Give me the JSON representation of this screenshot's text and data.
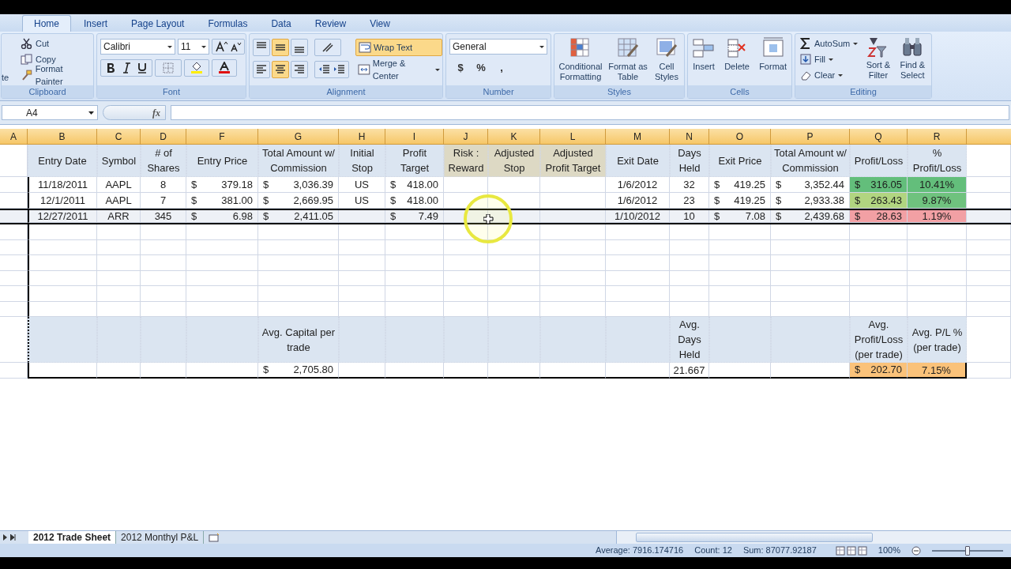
{
  "ribbon_tabs": [
    {
      "label": "Home",
      "selected": true
    },
    {
      "label": "Insert",
      "selected": false
    },
    {
      "label": "Page Layout",
      "selected": false
    },
    {
      "label": "Formulas",
      "selected": false
    },
    {
      "label": "Data",
      "selected": false
    },
    {
      "label": "Review",
      "selected": false
    },
    {
      "label": "View",
      "selected": false
    }
  ],
  "clipboard": {
    "group": "Clipboard",
    "paste_label": "te",
    "items": [
      "Cut",
      "Copy",
      "Format Painter"
    ]
  },
  "font": {
    "group": "Font",
    "name": "Calibri",
    "size": "11"
  },
  "alignment": {
    "group": "Alignment",
    "vertical_buttons": [
      {
        "selected": false
      },
      {
        "selected": true
      },
      {
        "selected": false
      }
    ],
    "horizontal_buttons": [
      {
        "selected": false
      },
      {
        "selected": true
      },
      {
        "selected": false
      }
    ],
    "wrap_text": {
      "label": "Wrap Text",
      "on": true
    },
    "merge": "Merge & Center"
  },
  "number": {
    "group": "Number",
    "format": "General",
    "symbols": [
      "$",
      "%",
      ","
    ]
  },
  "styles": {
    "group": "Styles",
    "items": [
      "Conditional Formatting",
      "Format as Table",
      "Cell Styles"
    ]
  },
  "cells": {
    "group": "Cells",
    "items": [
      "Insert",
      "Delete",
      "Format"
    ]
  },
  "editing": {
    "group": "Editing",
    "items": [
      "AutoSum",
      "Fill",
      "Clear"
    ],
    "big_items": [
      "Sort & Filter",
      "Find & Select"
    ]
  },
  "formula_bar": {
    "name_box": "A4",
    "function_label": "fx"
  },
  "sheet": {
    "columns": [
      {
        "letter": "A",
        "selected": true
      },
      {
        "letter": "B",
        "selected": true
      },
      {
        "letter": "C",
        "selected": true
      },
      {
        "letter": "D",
        "selected": true
      },
      {
        "letter": "F",
        "selected": true
      },
      {
        "letter": "G",
        "selected": true
      },
      {
        "letter": "H",
        "selected": true
      },
      {
        "letter": "I",
        "selected": true
      },
      {
        "letter": "J",
        "selected": true
      },
      {
        "letter": "K",
        "selected": true
      },
      {
        "letter": "L",
        "selected": true
      },
      {
        "letter": "M",
        "selected": true
      },
      {
        "letter": "N",
        "selected": true
      },
      {
        "letter": "O",
        "selected": true
      },
      {
        "letter": "P",
        "selected": true
      },
      {
        "letter": "Q",
        "selected": true
      },
      {
        "letter": "R",
        "selected": true
      }
    ],
    "header": {
      "b": {
        "text": "Entry Date",
        "color": "#dbe5f1"
      },
      "c": {
        "text": "Symbol",
        "color": "#dbe5f1"
      },
      "d": {
        "text": "# of Shares",
        "color": "#dbe5f1"
      },
      "f": {
        "text": "Entry Price",
        "color": "#dbe5f1"
      },
      "g": {
        "text": "Total Amount w/ Commission",
        "color": "#dbe5f1"
      },
      "h": {
        "text": "Initial Stop",
        "color": "#dbe5f1"
      },
      "i": {
        "text": "Profit Target",
        "color": "#dbe5f1"
      },
      "j": {
        "text": "Risk : Reward",
        "color": "#ddd9c4"
      },
      "k": {
        "text": "Adjusted Stop",
        "color": "#ddd9c4"
      },
      "l": {
        "text": "Adjusted Profit Target",
        "color": "#ddd9c4"
      },
      "m": {
        "text": "Exit Date",
        "color": "#dbe5f1"
      },
      "n": {
        "text": "Days Held",
        "color": "#dbe5f1"
      },
      "o": {
        "text": "Exit Price",
        "color": "#dbe5f1"
      },
      "p": {
        "text": "Total Amount w/ Commission",
        "color": "#dbe5f1"
      },
      "q": {
        "text": "Profit/Loss",
        "color": "#dbe5f1"
      },
      "r": {
        "text": "% Profit/Loss",
        "color": "#dbe5f1"
      }
    },
    "rows": [
      {
        "selected": false,
        "cells": {
          "b": {
            "text": "11/18/2011"
          },
          "c": {
            "text": "AAPL"
          },
          "d": {
            "text": "8"
          },
          "f": {
            "currency": "$",
            "amount": "379.18"
          },
          "g": {
            "currency": "$",
            "amount": "3,036.39"
          },
          "h": {
            "text": "US"
          },
          "i": {
            "currency": "$",
            "amount": "418.00"
          },
          "m": {
            "text": "1/6/2012"
          },
          "n": {
            "text": "32"
          },
          "o": {
            "currency": "$",
            "amount": "419.25"
          },
          "p": {
            "currency": "$",
            "amount": "3,352.44"
          },
          "q": {
            "currency": "$",
            "amount": "316.05",
            "color": "#63be7b"
          },
          "r": {
            "text": "10.41%",
            "color": "#63be7b"
          }
        }
      },
      {
        "selected": false,
        "cells": {
          "b": {
            "text": "12/1/2011"
          },
          "c": {
            "text": "AAPL"
          },
          "d": {
            "text": "7"
          },
          "f": {
            "currency": "$",
            "amount": "381.00"
          },
          "g": {
            "currency": "$",
            "amount": "2,669.95"
          },
          "h": {
            "text": "US"
          },
          "i": {
            "currency": "$",
            "amount": "418.00"
          },
          "m": {
            "text": "1/6/2012"
          },
          "n": {
            "text": "23"
          },
          "o": {
            "currency": "$",
            "amount": "419.25"
          },
          "p": {
            "currency": "$",
            "amount": "2,933.38"
          },
          "q": {
            "currency": "$",
            "amount": "263.43",
            "color": "#b1d580"
          },
          "r": {
            "text": "9.87%",
            "color": "#6fc27e"
          }
        }
      },
      {
        "selected": true,
        "cells": {
          "b": {
            "text": "12/27/2011"
          },
          "c": {
            "text": "ARR"
          },
          "d": {
            "text": "345"
          },
          "f": {
            "currency": "$",
            "amount": "6.98"
          },
          "g": {
            "currency": "$",
            "amount": "2,411.05"
          },
          "i": {
            "currency": "$",
            "amount": "7.49"
          },
          "m": {
            "text": "1/10/2012"
          },
          "n": {
            "text": "10"
          },
          "o": {
            "currency": "$",
            "amount": "7.08"
          },
          "p": {
            "currency": "$",
            "amount": "2,439.68"
          },
          "q": {
            "currency": "$",
            "amount": "28.63",
            "color": "#f2a0a4"
          },
          "r": {
            "text": "1.19%",
            "color": "#f2a0a4"
          }
        }
      }
    ],
    "summary_header": {
      "g": {
        "text": "Avg. Capital per trade"
      },
      "n": {
        "text": "Avg. Days Held"
      },
      "q": {
        "text": "Avg. Profit/Loss (per trade)"
      },
      "r": {
        "text": "Avg. P/L % (per trade)"
      }
    },
    "summary_values": {
      "g": {
        "currency": "$",
        "amount": "2,705.80"
      },
      "n": {
        "text": "21.667"
      },
      "q": {
        "currency": "$",
        "amount": "202.70",
        "color": "#fac27a"
      },
      "r": {
        "text": "7.15%",
        "color": "#fac27a"
      }
    }
  },
  "sheet_tabs": [
    {
      "label": "2012 Trade Sheet",
      "selected": true
    },
    {
      "label": "2012 Monthyl P&L",
      "selected": false
    }
  ],
  "status_bar": {
    "average": "Average: 7916.174716",
    "count": "Count: 12",
    "sum": "Sum: 87077.92187",
    "zoom": "100%",
    "zoom_slider": {
      "level": 0.5
    }
  }
}
